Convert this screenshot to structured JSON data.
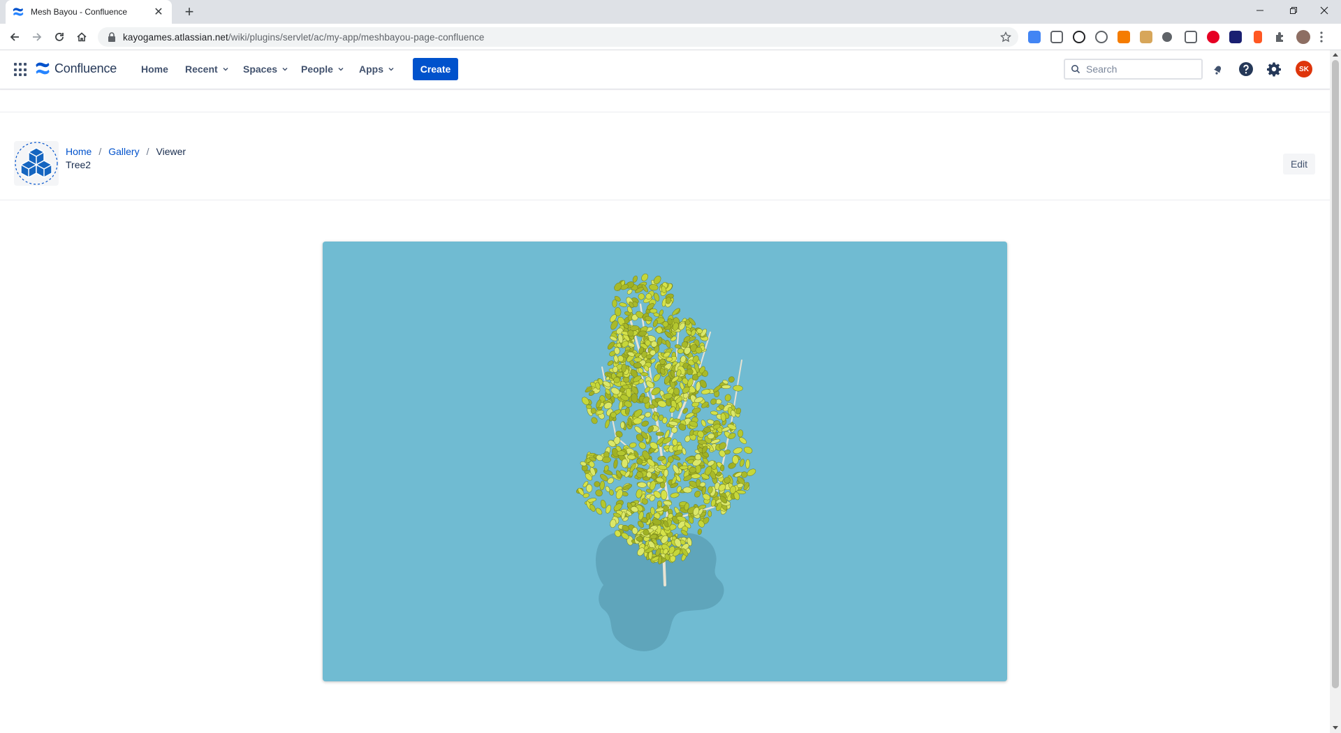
{
  "browser": {
    "tab_title": "Mesh Bayou - Confluence",
    "url_host": "kayogames.atlassian.net",
    "url_path": "/wiki/plugins/servlet/ac/my-app/meshbayou-page-confluence"
  },
  "app": {
    "product_name": "Confluence",
    "nav": {
      "home": "Home",
      "recent": "Recent",
      "spaces": "Spaces",
      "people": "People",
      "apps": "Apps"
    },
    "create_label": "Create",
    "search_placeholder": "Search",
    "avatar_initials": "SK",
    "brand_color": "#0052cc",
    "avatar_color": "#de350b"
  },
  "page": {
    "breadcrumbs": [
      "Home",
      "Gallery",
      "Viewer"
    ],
    "title": "Tree2",
    "edit_label": "Edit"
  },
  "viewer": {
    "background_color": "#70bbd2",
    "model": "tree"
  }
}
